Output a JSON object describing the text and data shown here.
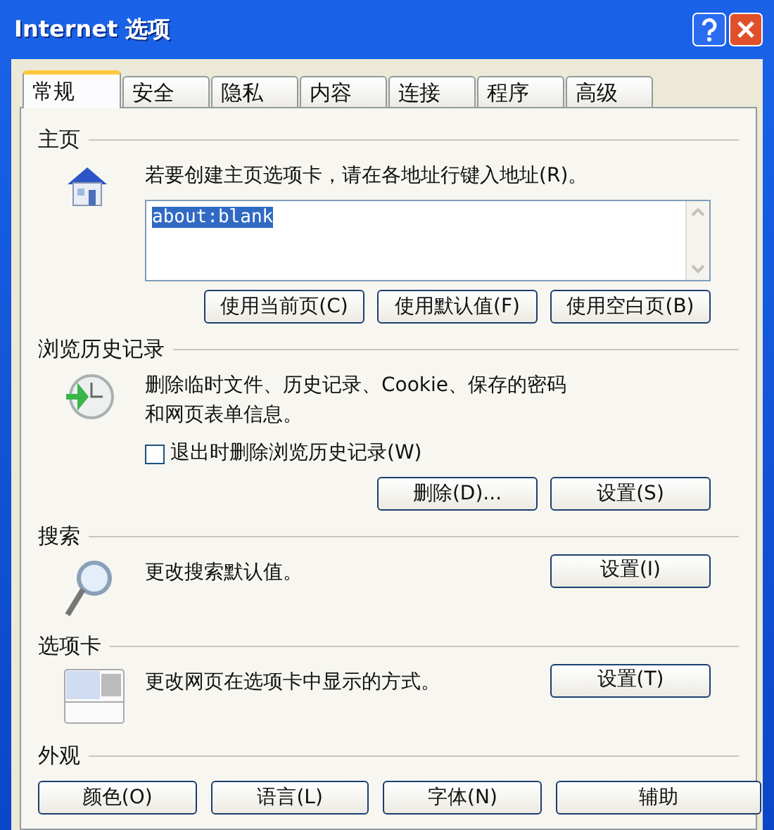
{
  "window": {
    "title": "Internet 选项"
  },
  "tabs": [
    {
      "label": "常规",
      "selected": true
    },
    {
      "label": "安全",
      "selected": false
    },
    {
      "label": "隐私",
      "selected": false
    },
    {
      "label": "内容",
      "selected": false
    },
    {
      "label": "连接",
      "selected": false
    },
    {
      "label": "程序",
      "selected": false
    },
    {
      "label": "高级",
      "selected": false
    }
  ],
  "sections": [
    {
      "kind": "homepage",
      "heading": "主页",
      "description": "若要创建主页选项卡，请在各地址行键入地址(R)。",
      "addresses": [
        {
          "text": "about:blank",
          "selected": true
        }
      ],
      "buttons": [
        "使用当前页(C)",
        "使用默认值(F)",
        "使用空白页(B)"
      ]
    },
    {
      "kind": "history",
      "heading": "浏览历史记录",
      "description": "删除临时文件、历史记录、Cookie、保存的密码和网页表单信息。",
      "checkbox": {
        "label": "退出时删除浏览历史记录(W)",
        "checked": false
      },
      "buttons": [
        "删除(D)...",
        "设置(S)"
      ]
    },
    {
      "kind": "search",
      "heading": "搜索",
      "description": "更改搜索默认值。",
      "buttons": [
        "设置(I)"
      ]
    },
    {
      "kind": "tabs",
      "heading": "选项卡",
      "description": "更改网页在选项卡中显示的方式。",
      "buttons": [
        "设置(T)"
      ]
    },
    {
      "kind": "appearance",
      "heading": "外观",
      "buttons": [
        "颜色(O)",
        "语言(L)",
        "字体(N)",
        "辅助"
      ]
    }
  ]
}
